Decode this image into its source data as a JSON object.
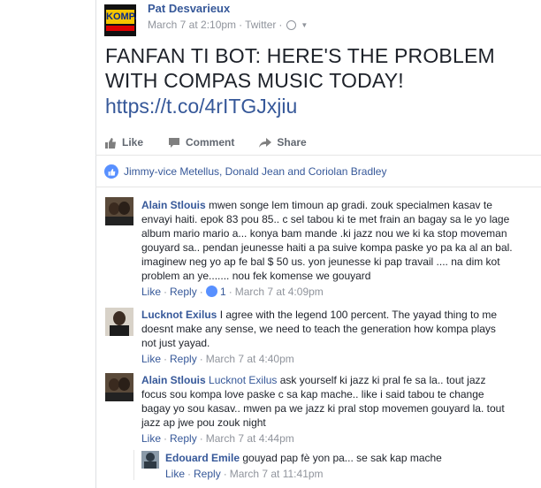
{
  "post": {
    "author": "Pat Desvarieux",
    "logo_text": "KOMPA",
    "timestamp": "March 7 at 2:10pm",
    "source": "Twitter",
    "text": "FANFAN TI BOT: HERE'S THE PROBLEM WITH COMPAS MUSIC TODAY!",
    "link": "https://t.co/4rITGJxjiu",
    "actions": {
      "like": "Like",
      "comment": "Comment",
      "share": "Share"
    },
    "likers": "Jimmy-vice Metellus, Donald Jean and Coriolan Bradley"
  },
  "comments": [
    {
      "author": "Alain Stlouis",
      "text": "mwen songe lem timoun ap gradi. zouk specialmen kasav te envayi haiti. epok 83 pou 85.. c sel tabou ki te met frain an bagay sa le yo lage album mario mario a... konya bam mande .ki jazz nou we ki ka stop moveman gouyard sa.. pendan jeunesse haiti a pa suive kompa paske yo pa ka al an bal. imaginew neg yo ap fe bal $ 50 us. yon jeunesse ki pap travail .... na dim kot problem an ye....... nou fek komense we gouyard",
      "like": "Like",
      "reply": "Reply",
      "like_count": "1",
      "time": "March 7 at 4:09pm"
    },
    {
      "author": "Lucknot Exilus",
      "text": "I agree with the legend 100 percent. The yayad thing to me doesnt make any sense, we need to teach the generation how kompa plays not just yayad.",
      "like": "Like",
      "reply": "Reply",
      "time": "March 7 at 4:40pm"
    },
    {
      "author": "Alain Stlouis",
      "mention": "Lucknot Exilus",
      "text": "ask yourself ki jazz ki pral fe sa la.. tout jazz focus sou kompa love paske c sa kap mache.. like i said tabou te change bagay yo sou kasav.. mwen pa we jazz ki pral stop movemen gouyard la. tout jazz ap jwe pou zouk night",
      "like": "Like",
      "reply": "Reply",
      "time": "March 7 at 4:44pm"
    },
    {
      "author": "Edouard Emile",
      "text": "gouyad pap fè yon pa... se sak kap mache",
      "like": "Like",
      "reply": "Reply",
      "time": "March 7 at 11:41pm"
    }
  ],
  "colors": {
    "link": "#365899",
    "meta": "#90949c",
    "like_badge": "#5890ff"
  }
}
